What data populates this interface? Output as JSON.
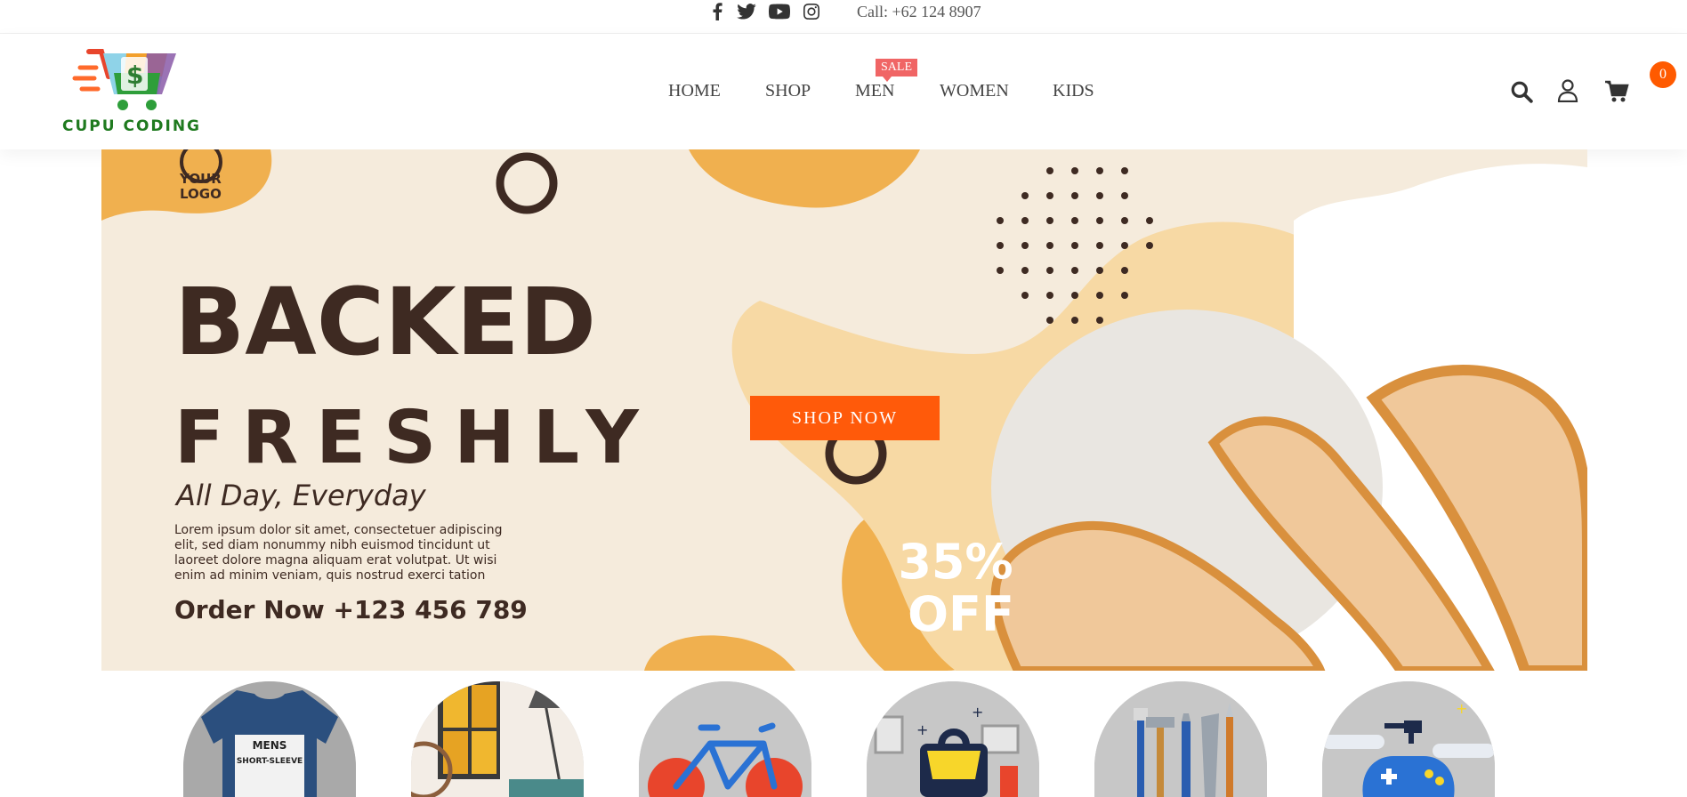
{
  "topbar": {
    "social": [
      "facebook-icon",
      "twitter-icon",
      "youtube-icon",
      "instagram-icon"
    ],
    "call": "Call: +62 124 8907"
  },
  "brand": {
    "name": "CUPU CODING"
  },
  "nav": {
    "items": [
      "HOME",
      "SHOP",
      "MEN",
      "WOMEN",
      "KIDS"
    ],
    "sale_badge": "SALE"
  },
  "header_icons": {
    "search": "search-icon",
    "user": "user-icon",
    "cart": "cart-icon",
    "cart_count": "0"
  },
  "banner": {
    "logo_text_1": "YOUR",
    "logo_text_2": "LOGO",
    "headline_1": "BACKED",
    "headline_2": "FRESHLY",
    "tagline": "All Day, Everyday",
    "body_1": "Lorem ipsum dolor sit amet, consectetuer adipiscing",
    "body_2": "elit, sed diam nonummy nibh euismod tincidunt ut",
    "body_3": "laoreet dolore magna aliquam erat volutpat. Ut wisi",
    "body_4": "enim ad minim veniam, quis nostrud exerci tation",
    "order": "Order Now  +123 456 789",
    "discount_1": "35%",
    "discount_2": "OFF",
    "cta": "SHOP NOW"
  },
  "categories": [
    {
      "icon": "tshirt-icon",
      "text_1": "MENS",
      "text_2": "SHORT-SLEEVE"
    },
    {
      "icon": "home-decor-icon"
    },
    {
      "icon": "bicycle-icon"
    },
    {
      "icon": "bag-icon"
    },
    {
      "icon": "tools-icon"
    },
    {
      "icon": "gamepad-icon"
    }
  ],
  "colors": {
    "accent": "#ff5a0a",
    "sale": "#f06565",
    "banner_bg": "#f5ebdc",
    "blob": "#f0b04f",
    "text_dark": "#3e2a22"
  }
}
